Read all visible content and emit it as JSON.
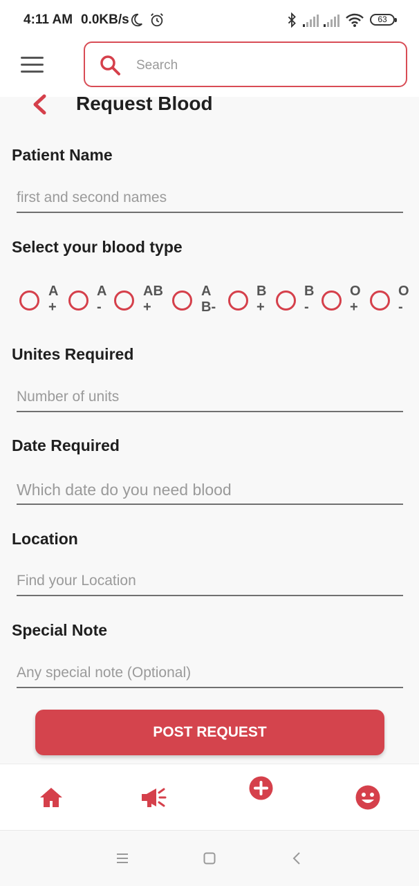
{
  "status": {
    "time": "4:11 AM",
    "speed": "0.0KB/s",
    "battery": "63",
    "icons": [
      "moon-icon",
      "alarm-icon",
      "bluetooth-icon",
      "signal-icon",
      "signal-icon",
      "wifi-icon",
      "battery-icon"
    ]
  },
  "search": {
    "placeholder": "Search"
  },
  "page": {
    "title": "Request Blood"
  },
  "form": {
    "patient_name_label": "Patient Name",
    "patient_name_placeholder": "first and second names",
    "blood_type_label": "Select your blood type",
    "blood_types": [
      {
        "line1": "A",
        "line2": "+"
      },
      {
        "line1": "A",
        "line2": "-"
      },
      {
        "line1": "AB",
        "line2": "+"
      },
      {
        "line1": "A",
        "line2": "B-"
      },
      {
        "line1": "B",
        "line2": "+"
      },
      {
        "line1": "B",
        "line2": "-"
      },
      {
        "line1": "O",
        "line2": "+"
      },
      {
        "line1": "O",
        "line2": "-"
      }
    ],
    "units_label": "Unites Required",
    "units_placeholder": "Number of units",
    "date_label": "Date Required",
    "date_placeholder": "Which date do you need blood",
    "location_label": "Location",
    "location_placeholder": "Find your Location",
    "note_label": "Special Note",
    "note_placeholder": "Any special note (Optional)",
    "submit_label": "POST REQUEST"
  },
  "nav": {
    "items": [
      "home-icon",
      "megaphone-icon",
      "add-circle-icon",
      "smiley-icon"
    ]
  },
  "colors": {
    "accent": "#d4444d"
  }
}
